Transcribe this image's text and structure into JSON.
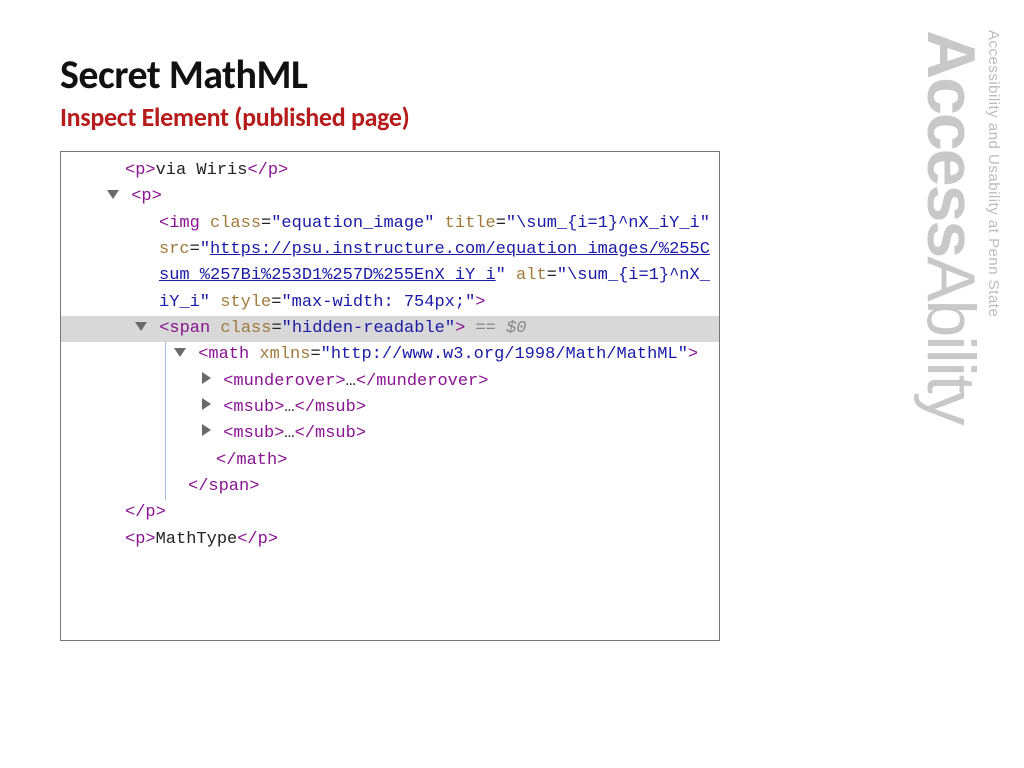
{
  "title": "Secret MathML",
  "subtitle": "Inspect Element (published page)",
  "brand": {
    "word1": "Access",
    "word2": "Ability",
    "tagline": "Accessibility and Usability at Penn State"
  },
  "code": {
    "l1_open": "<p>",
    "l1_text": "via Wiris",
    "l1_close": "</p>",
    "l2": "<p>",
    "img_open": "<img",
    "img_class_attr": " class",
    "img_class_val": "\"equation_image\"",
    "img_title_attr": " title",
    "img_title_val": "\"\\sum_{i=1}^nX_iY_i\"",
    "img_src_attr": " src",
    "img_src_link": "https://psu.instructure.com/equation_images/%255Csum_%257Bi%253D1%257D%255EnX_iY_i",
    "img_alt_attr": " alt",
    "img_alt_val": "\"\\sum_{i=1}^nX_iY_i\"",
    "img_style_attr": " style",
    "img_style_val": "\"max-width: 754px;\"",
    "img_end": ">",
    "span_open": "<span",
    "span_class_attr": " class",
    "span_class_val": "\"hidden-readable\"",
    "span_end": ">",
    "sel_marker": " == $0",
    "math_open": "<math",
    "math_xmlns_attr": " xmlns",
    "math_xmlns_val": "\"http://www.w3.org/1998/Math/MathML\"",
    "math_end": ">",
    "munder_open": "<munderover>",
    "ellipsis": "…",
    "munder_close": "</munderover>",
    "msub_open": "<msub>",
    "msub_close": "</msub>",
    "math_close": "</math>",
    "span_close": "</span>",
    "p_close": "</p>",
    "last_open": "<p>",
    "last_text": "MathType",
    "last_close": "</p>"
  }
}
